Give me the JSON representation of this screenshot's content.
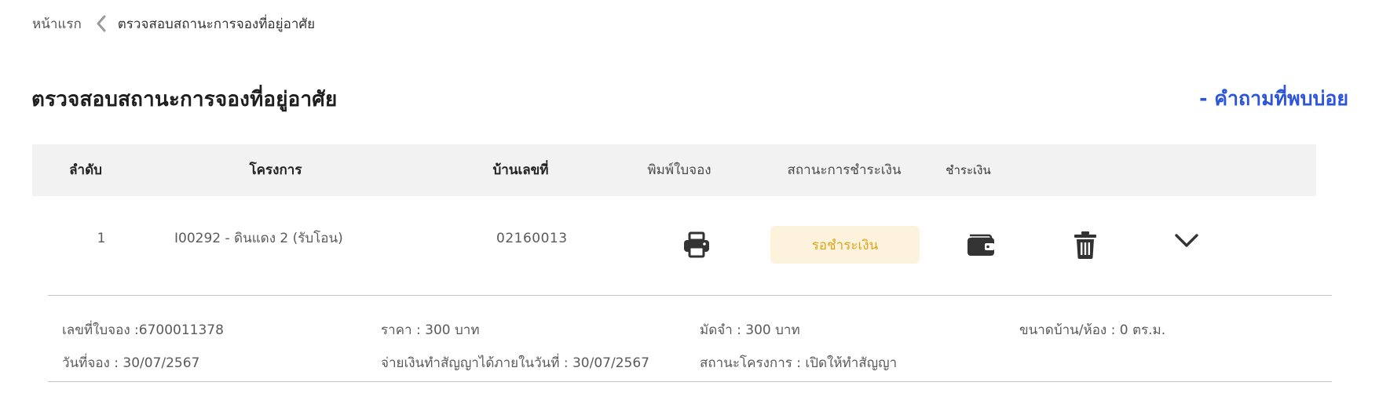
{
  "breadcrumb": {
    "home": "หน้าแรก",
    "current": "ตรวจสอบสถานะการจองที่อยู่อาศัย"
  },
  "page": {
    "title": "ตรวจสอบสถานะการจองที่อยู่อาศัย",
    "faq_link": "- คำถามที่พบบ่อย"
  },
  "table": {
    "headers": {
      "no": "ลำดับ",
      "project": "โครงการ",
      "house_no": "บ้านเลขที่",
      "print": "พิมพ์ใบจอง",
      "payment_status": "สถานะการชำระเงิน",
      "pay": "ชำระเงิน"
    },
    "rows": [
      {
        "no": "1",
        "project": "I00292 - ดินแดง 2 (รับโอน)",
        "house_no": "02160013",
        "status": "รอชำระเงิน",
        "icons": {
          "print": "printer-icon",
          "pay": "wallet-icon",
          "delete": "trash-icon",
          "expand": "chevron-down-icon"
        },
        "details": {
          "booking_no": "เลขที่ใบจอง :6700011378",
          "price": "ราคา : 300 บาท",
          "deposit": "มัดจำ : 300 บาท",
          "size": "ขนาดบ้าน/ห้อง : 0 ตร.ม.",
          "booking_date": "วันที่จอง : 30/07/2567",
          "contract_date": "จ่ายเงินทำสัญญาได้ภายในวันที่ : 30/07/2567",
          "project_status": "สถานะโครงการ : เปิดให้ทำสัญญา"
        }
      }
    ]
  },
  "colors": {
    "accent": "#2d55d9",
    "header_bg": "#f2f2f2",
    "status_bg": "#fdf3dd",
    "status_text": "#e0a41c",
    "icon": "#333333"
  }
}
